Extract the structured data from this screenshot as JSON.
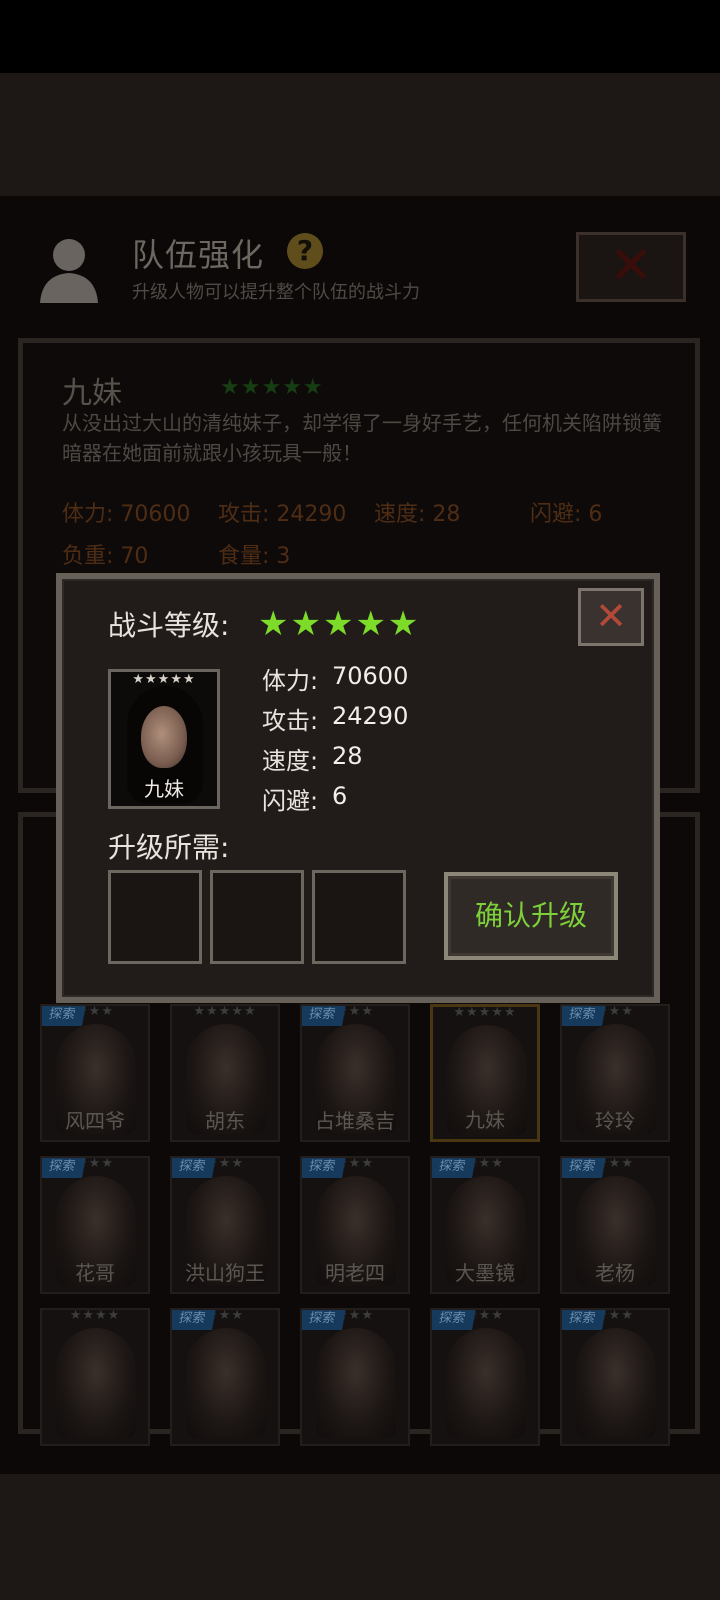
{
  "header": {
    "title": "队伍强化",
    "help_icon_text": "?",
    "subtitle": "升级人物可以提升整个队伍的战斗力",
    "close_icon": "close-icon"
  },
  "info": {
    "name": "九妹",
    "stars": "★★★★★",
    "description": "从没出过大山的清纯妹子，却学得了一身好手艺，任何机关陷阱锁簧暗器在她面前就跟小孩玩具一般！",
    "stats": [
      {
        "label": "体力: 70600"
      },
      {
        "label": "攻击: 24290"
      },
      {
        "label": "速度: 28"
      },
      {
        "label": "闪避: 6"
      },
      {
        "label": "负重: 70"
      },
      {
        "label": "食量: 3"
      }
    ]
  },
  "dialog": {
    "level_label": "战斗等级:",
    "level_stars": "★★★★★",
    "close_text": "✕",
    "portrait_stars": "★★★★★",
    "portrait_name": "九妹",
    "stats": [
      {
        "label": "体力:",
        "value": "70600"
      },
      {
        "label": "攻击:",
        "value": "24290"
      },
      {
        "label": "速度:",
        "value": "28"
      },
      {
        "label": "闪避:",
        "value": "6"
      }
    ],
    "requirements_label": "升级所需:",
    "confirm_label": "确认升级"
  },
  "roster": {
    "tag_text": "探索",
    "rows": [
      [
        {
          "name": "风四爷",
          "stars": "★★★",
          "tag": true
        },
        {
          "name": "胡东",
          "stars": "★★★★★",
          "tag": false
        },
        {
          "name": "占堆桑吉",
          "stars": "★★★",
          "tag": true
        },
        {
          "name": "九妹",
          "stars": "★★★★★",
          "tag": false,
          "selected": true
        },
        {
          "name": "玲玲",
          "stars": "★★★",
          "tag": true
        }
      ],
      [
        {
          "name": "花哥",
          "stars": "★★★",
          "tag": true
        },
        {
          "name": "洪山狗王",
          "stars": "★★★",
          "tag": true
        },
        {
          "name": "明老四",
          "stars": "★★★",
          "tag": true
        },
        {
          "name": "大墨镜",
          "stars": "★★★",
          "tag": true
        },
        {
          "name": "老杨",
          "stars": "★★★",
          "tag": true
        }
      ],
      [
        {
          "name": "",
          "stars": "★★★★",
          "tag": false
        },
        {
          "name": "",
          "stars": "★★★",
          "tag": true
        },
        {
          "name": "",
          "stars": "★★★",
          "tag": true
        },
        {
          "name": "",
          "stars": "★★★",
          "tag": true
        },
        {
          "name": "",
          "stars": "★★★",
          "tag": true
        }
      ]
    ]
  },
  "colors": {
    "dialog_bg": "#211c1a",
    "star_green": "#7ddb2a",
    "confirm_text": "#7ed03a",
    "close_x": "#b4493a"
  }
}
